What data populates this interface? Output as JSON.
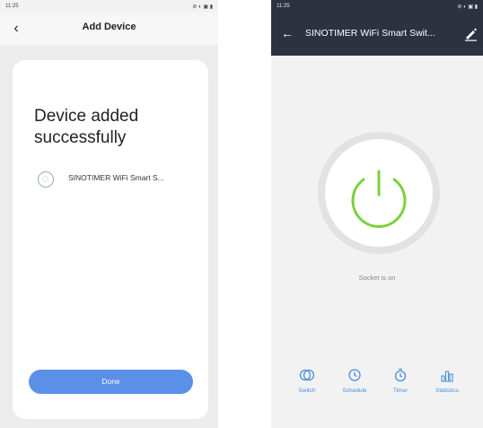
{
  "left": {
    "status_time": "11:25",
    "status_icons": "⊘ ◐ ▣ ▮",
    "header_title": "Add Device",
    "added_title": "Device added successfully",
    "device_name": "SINOTIMER WiFi Smart S...",
    "done_label": "Done"
  },
  "right": {
    "status_time": "11:25",
    "status_icons": "⊘ ◐ ▣ ▮",
    "header_title": "SINOTIMER WiFi Smart Swit...",
    "socket_status": "Socket is on",
    "nav": [
      {
        "label": "Switch",
        "icon": "switch-icon"
      },
      {
        "label": "Schedule",
        "icon": "clock-icon"
      },
      {
        "label": "Timer",
        "icon": "timer-icon"
      },
      {
        "label": "Statistics",
        "icon": "bar-chart-icon"
      }
    ],
    "colors": {
      "header_bg": "#2d3240",
      "power_green": "#7bd13a",
      "accent_blue": "#4a8fe0",
      "done_button": "#5a90e8"
    }
  }
}
